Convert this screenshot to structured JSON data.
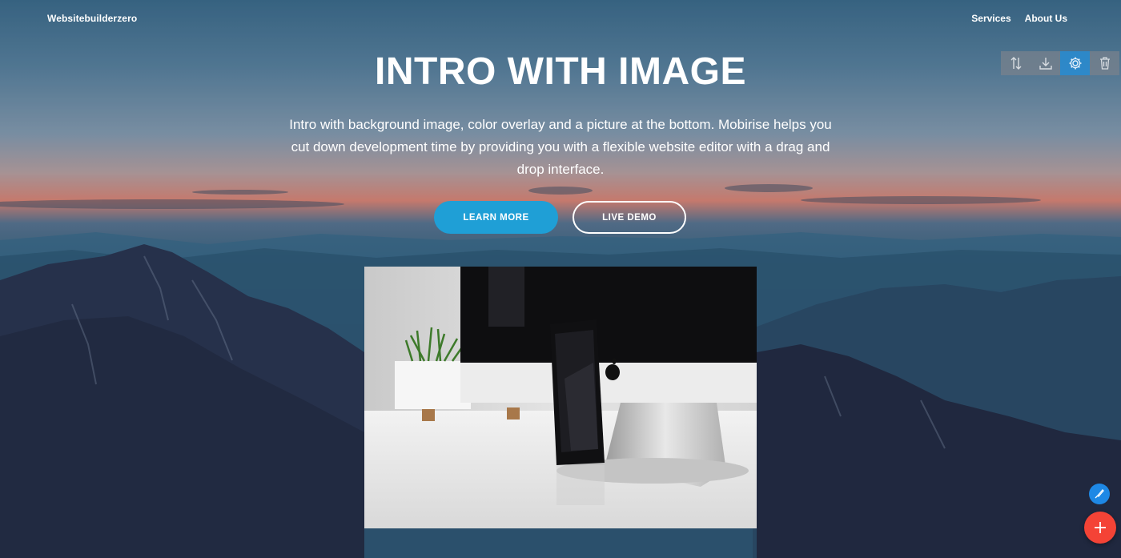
{
  "brand": {
    "name": "Websitebuilderzero"
  },
  "nav": {
    "items": [
      {
        "label": "Services"
      },
      {
        "label": "About Us"
      }
    ]
  },
  "hero": {
    "title": "INTRO WITH IMAGE",
    "description": "Intro with background image, color overlay and a picture at the bottom. Mobirise helps you cut down development time by providing you with a flexible website editor with a drag and drop interface.",
    "primary_button": "LEARN MORE",
    "secondary_button": "LIVE DEMO"
  },
  "toolbar": {
    "tools": [
      "move-icon",
      "download-icon",
      "gear-icon",
      "trash-icon"
    ],
    "active_tool": "gear-icon"
  },
  "fabs": {
    "brush": "brush-icon",
    "add": "plus-icon"
  },
  "colors": {
    "primary_button": "#1f9fd6",
    "toolbar_active": "#288cd2",
    "fab_brush": "#1e88e5",
    "fab_add": "#f44336"
  }
}
